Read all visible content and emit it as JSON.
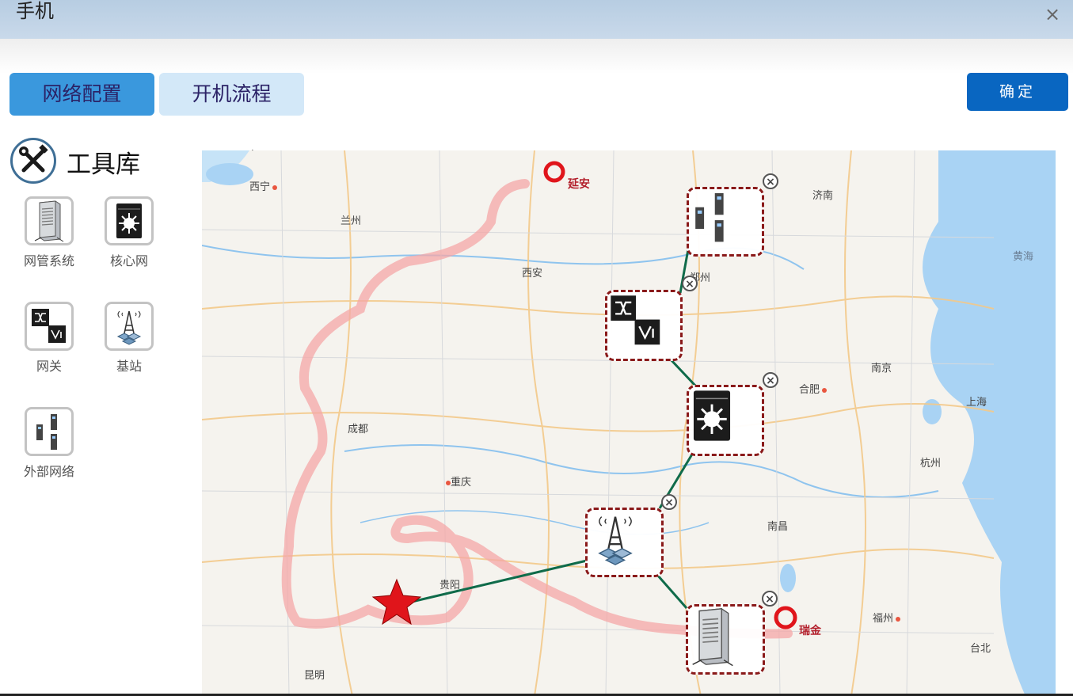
{
  "window": {
    "title": "手机",
    "close_glyph": "×"
  },
  "tabs": [
    {
      "label": "网络配置",
      "active": true
    },
    {
      "label": "开机流程",
      "active": false
    }
  ],
  "confirm_label": "确定",
  "toolbox": {
    "title": "工具库",
    "icon": "wrench-screwdriver-icon",
    "items": [
      {
        "label": "网管系统",
        "icon": "server-icon"
      },
      {
        "label": "核心网",
        "icon": "core-network-icon"
      },
      {
        "label": "网关",
        "icon": "gateway-icon"
      },
      {
        "label": "基站",
        "icon": "base-station-icon"
      },
      {
        "label": "外部网络",
        "icon": "external-network-icon"
      }
    ]
  },
  "map": {
    "cities": [
      "西宁",
      "兰州",
      "西安",
      "郑州",
      "济南",
      "黄海",
      "南京",
      "合肥",
      "上海",
      "杭州",
      "成都",
      "重庆",
      "贵阳",
      "南昌",
      "福州",
      "台北",
      "昆明"
    ],
    "markers": {
      "start": "延安",
      "end": "瑞金"
    },
    "remove_glyph": "×"
  },
  "colors": {
    "accent": "#0966c1",
    "tab_active": "#3a98dd",
    "tab_inactive": "#d3e8f8",
    "node_border": "#8a1a1a",
    "link": "#0f6b4a",
    "route": "#f4a7a7",
    "star": "#e0151b"
  }
}
